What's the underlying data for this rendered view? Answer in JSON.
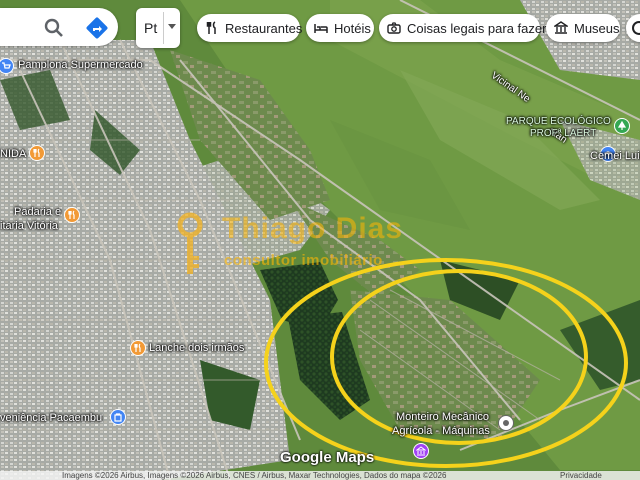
{
  "search": {
    "icon": "search-icon",
    "directions_icon": "directions-icon"
  },
  "language": {
    "label": "Pt"
  },
  "chips": [
    {
      "label": "Restaurantes",
      "icon": "restaurant-icon"
    },
    {
      "label": "Hotéis",
      "icon": "hotel-icon"
    },
    {
      "label": "Coisas legais para fazer",
      "icon": "camera-icon"
    },
    {
      "label": "Museus",
      "icon": "museum-icon"
    }
  ],
  "places": {
    "supermarket": "Pamplona Supermercado",
    "nida": "NIDA",
    "bakery_line1": "Padaria e",
    "bakery_line2": "itaria Vitória",
    "lanche": "Lanche dois irmãos",
    "conveniencia": "veniência Pacaembu",
    "park_line1": "PARQUE ECOLÓGICO",
    "park_line2": "PROFª LAERT",
    "cemei": "Cemei Luiza G",
    "mechanic_line1": "Monteiro Mecânico",
    "mechanic_line2": "Agrícola - Máquinas"
  },
  "roads": {
    "vicinal": "Vicinal Ne",
    "vicinal2": "utan"
  },
  "watermark": {
    "line1": "Thiago Dias",
    "line2": "consultor imobiliário"
  },
  "google_logo": "Google Maps",
  "attribution": "Imagens ©2026 Airbus, Imagens ©2026 Airbus, CNES / Airbus, Maxar Technologies, Dados do mapa ©2026",
  "privacy": "Privacidade",
  "colors": {
    "highlight_ring": "#f5d21b",
    "restaurant_pin": "#f29a36",
    "shop_pin": "#4285f4",
    "park_pin": "#34a853",
    "museum_pin": "#a142f4"
  }
}
